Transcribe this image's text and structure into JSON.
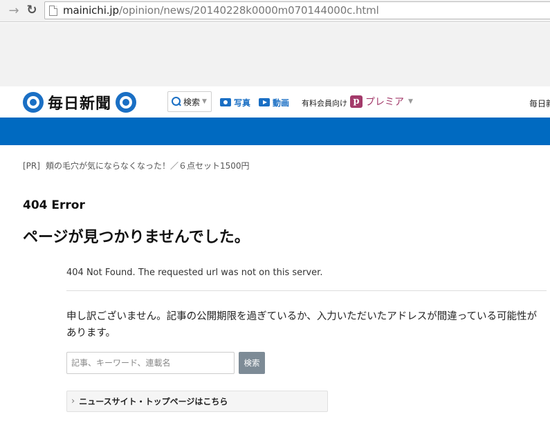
{
  "browser": {
    "url_host": "mainichi.jp",
    "url_path": "/opinion/news/20140228k0000m070144000c.html"
  },
  "header": {
    "logo_text": "毎日新聞",
    "search_label": "検索",
    "photo_label": "写真",
    "video_label": "動画",
    "paid_label": "有料会員向け",
    "premier_label": "プレミア",
    "right_text": "毎日新"
  },
  "pr": {
    "tag": "[PR]",
    "text": "頬の毛穴が気にならなくなった！／６点セット1500円"
  },
  "error": {
    "code": "404 Error",
    "title": "ページが見つかりませんでした。",
    "not_found": "404 Not Found. The requested url was not on this server.",
    "apology": "申し訳ございません。記事の公開期限を過ぎているか、入力いただいたアドレスが間違っている可能性があります。"
  },
  "search": {
    "placeholder": "記事、キーワード、連載名",
    "button_label": "検索"
  },
  "top_link": {
    "label": "ニュースサイト・トップページはこちら"
  },
  "colors": {
    "brand_blue": "#006ac1",
    "premier": "#a33a6a"
  }
}
